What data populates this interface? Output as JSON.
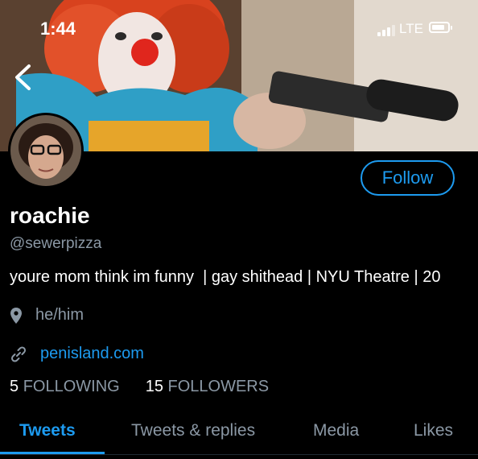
{
  "status_bar": {
    "time": "1:44",
    "network": "LTE"
  },
  "profile": {
    "name": "roachie",
    "handle": "@sewerpizza",
    "bio": "youre mom think im funny  | gay shithead | NYU Theatre | 20",
    "pronouns": "he/him",
    "link": "penisland.com",
    "following_count": "5",
    "following_label": "FOLLOWING",
    "followers_count": "15",
    "followers_label": "FOLLOWERS",
    "follow_button": "Follow"
  },
  "tabs": [
    {
      "label": "Tweets",
      "active": true
    },
    {
      "label": "Tweets & replies",
      "active": false
    },
    {
      "label": "Media",
      "active": false
    },
    {
      "label": "Likes",
      "active": false
    }
  ],
  "colors": {
    "accent": "#1d9bf0",
    "muted": "#8b98a5",
    "background": "#000000"
  }
}
